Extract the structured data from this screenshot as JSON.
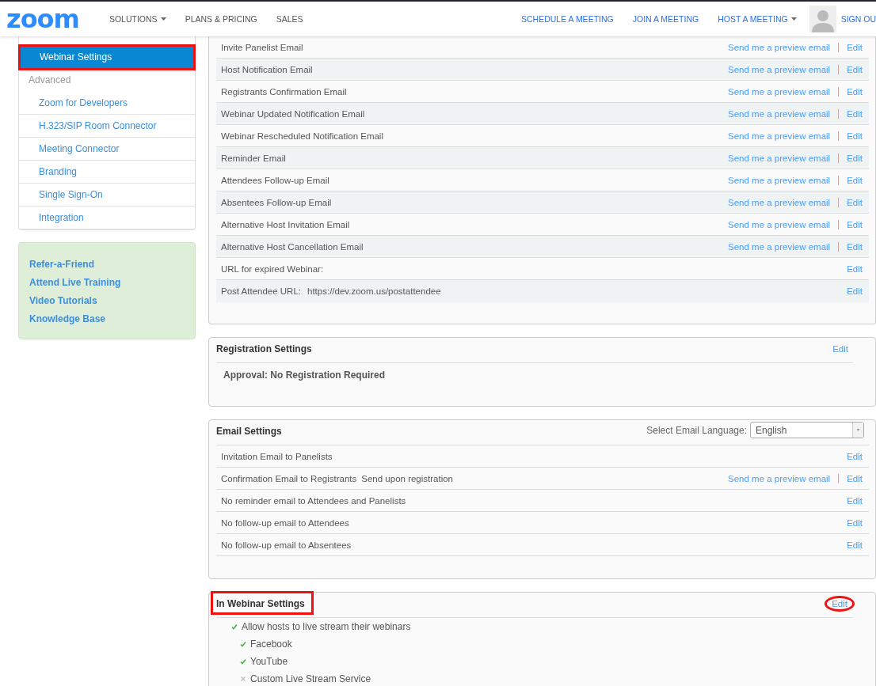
{
  "header": {
    "logo": "zoom",
    "nav_left": [
      {
        "label": "SOLUTIONS",
        "dropdown": true
      },
      {
        "label": "PLANS & PRICING",
        "dropdown": false
      },
      {
        "label": "SALES",
        "dropdown": false
      }
    ],
    "nav_right": [
      {
        "label": "SCHEDULE A MEETING",
        "dropdown": false
      },
      {
        "label": "JOIN A MEETING",
        "dropdown": false
      },
      {
        "label": "HOST A MEETING",
        "dropdown": true
      }
    ],
    "sign_out": "SIGN OU"
  },
  "sidebar": {
    "items": [
      {
        "kind": "item",
        "label": "Webinar Settings",
        "selected": true,
        "highlighted": true
      },
      {
        "kind": "group",
        "label": "Advanced"
      },
      {
        "kind": "item",
        "label": "Zoom for Developers",
        "selected": false,
        "highlighted": false
      },
      {
        "kind": "item",
        "label": "H.323/SIP Room Connector",
        "selected": false,
        "highlighted": false
      },
      {
        "kind": "item",
        "label": "Meeting Connector",
        "selected": false,
        "highlighted": false
      },
      {
        "kind": "item",
        "label": "Branding",
        "selected": false,
        "highlighted": false
      },
      {
        "kind": "item",
        "label": "Single Sign-On",
        "selected": false,
        "highlighted": false
      },
      {
        "kind": "item",
        "label": "Integration",
        "selected": false,
        "highlighted": false
      }
    ],
    "links": [
      "Refer-a-Friend",
      "Attend Live Training",
      "Video Tutorials",
      "Knowledge Base"
    ]
  },
  "email_templates": {
    "rows": [
      {
        "label": "Invite Panelist Email",
        "preview": "Send me a preview email",
        "edit": "Edit"
      },
      {
        "label": "Host Notification Email",
        "preview": "Send me a preview email",
        "edit": "Edit"
      },
      {
        "label": "Registrants Confirmation Email",
        "preview": "Send me a preview email",
        "edit": "Edit"
      },
      {
        "label": "Webinar Updated Notification Email",
        "preview": "Send me a preview email",
        "edit": "Edit"
      },
      {
        "label": "Webinar Rescheduled Notification Email",
        "preview": "Send me a preview email",
        "edit": "Edit"
      },
      {
        "label": "Reminder Email",
        "preview": "Send me a preview email",
        "edit": "Edit"
      },
      {
        "label": "Attendees Follow-up Email",
        "preview": "Send me a preview email",
        "edit": "Edit"
      },
      {
        "label": "Absentees Follow-up Email",
        "preview": "Send me a preview email",
        "edit": "Edit"
      },
      {
        "label": "Alternative Host Invitation Email",
        "preview": "Send me a preview email",
        "edit": "Edit"
      },
      {
        "label": "Alternative Host Cancellation Email",
        "preview": "Send me a preview email",
        "edit": "Edit"
      },
      {
        "label": "URL for expired Webinar:",
        "edit": "Edit"
      },
      {
        "label": "Post Attendee URL:",
        "value": "https://dev.zoom.us/postattendee",
        "edit": "Edit"
      }
    ]
  },
  "registration_settings": {
    "title": "Registration Settings",
    "edit": "Edit",
    "approval": "Approval: No Registration Required"
  },
  "email_settings": {
    "title": "Email Settings",
    "language_label": "Select Email Language:",
    "language": "English",
    "rows": [
      {
        "label": "Invitation Email to Panelists",
        "edit": "Edit"
      },
      {
        "label": "Confirmation Email to Registrants",
        "value": "Send upon registration",
        "preview": "Send me a preview email",
        "edit": "Edit"
      },
      {
        "label": "No reminder email to Attendees and Panelists",
        "edit": "Edit"
      },
      {
        "label": "No follow-up email to Attendees",
        "edit": "Edit"
      },
      {
        "label": "No follow-up email to Absentees",
        "edit": "Edit"
      }
    ]
  },
  "in_webinar_settings": {
    "title": "In Webinar Settings",
    "highlighted": true,
    "edit": "Edit",
    "edit_circled": true,
    "options": [
      {
        "label": "Allow hosts to live stream their webinars",
        "enabled": true,
        "children": [
          {
            "label": "Facebook",
            "enabled": true
          },
          {
            "label": "YouTube",
            "enabled": true
          },
          {
            "label": "Custom Live Stream Service",
            "enabled": false
          }
        ]
      }
    ]
  }
}
